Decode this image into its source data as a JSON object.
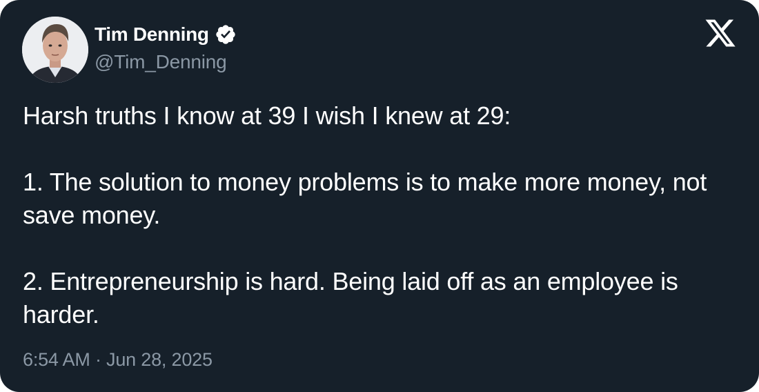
{
  "author": {
    "display_name": "Tim Denning",
    "handle": "@Tim_Denning",
    "verified": true,
    "avatar_icon": "person-photo-icon"
  },
  "brand": {
    "logo": "x-logo-icon"
  },
  "tweet": {
    "paragraphs": [
      "Harsh truths I know at 39 I wish I knew at 29:",
      "1. The solution to money problems is to make more money, not save money.",
      "2. Entrepreneurship is hard. Being laid off as an employee is harder."
    ]
  },
  "meta": {
    "timestamp": "6:54 AM · Jun 28, 2025"
  },
  "colors": {
    "background": "#16202a",
    "primary_text": "#ffffff",
    "secondary_text": "#8b98a5",
    "verified_badge": "#ffffff"
  }
}
